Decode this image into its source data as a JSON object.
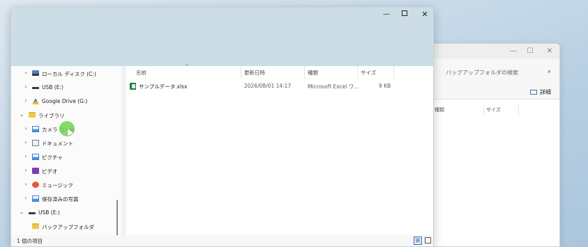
{
  "background_window": {
    "search_placeholder": "バックアップフォルダの検索",
    "detail_label": "詳細",
    "columns": [
      "種類",
      "サイズ"
    ],
    "controls": {
      "minimize": "—",
      "maximize": "☐",
      "close": "✕"
    }
  },
  "window": {
    "controls": {
      "minimize": "—",
      "close": "✕"
    }
  },
  "nav": {
    "items": [
      {
        "label": "ローカル ディスク (C:)",
        "icon": "drive-c-icon",
        "expanded": false
      },
      {
        "label": "USB (E:)",
        "icon": "usb-drive-icon",
        "expanded": false
      },
      {
        "label": "Google Drive (G:)",
        "icon": "google-drive-icon",
        "expanded": false
      },
      {
        "label": "ライブラリ",
        "icon": "folder-icon",
        "expanded": true
      },
      {
        "label": "カメラ ロール",
        "icon": "pictures-icon",
        "expanded": false
      },
      {
        "label": "ドキュメント",
        "icon": "documents-icon",
        "expanded": false
      },
      {
        "label": "ピクチャ",
        "icon": "pictures-icon",
        "expanded": false
      },
      {
        "label": "ビデオ",
        "icon": "video-icon",
        "expanded": false
      },
      {
        "label": "ミュージック",
        "icon": "music-icon",
        "expanded": false
      },
      {
        "label": "保存済みの写真",
        "icon": "pictures-icon",
        "expanded": false
      },
      {
        "label": "USB (E:)",
        "icon": "usb-drive-icon",
        "expanded": true
      },
      {
        "label": "バックアップフォルダ",
        "icon": "folder-icon",
        "expanded": false
      }
    ],
    "chevron_collapsed": "›",
    "chevron_expanded": "⌄"
  },
  "content": {
    "columns": {
      "name": "名前",
      "modified": "更新日時",
      "type": "種類",
      "size": "サイズ"
    },
    "sort_indicator": "^",
    "files": [
      {
        "name": "サンプルデータ.xlsx",
        "modified": "2026/08/01 14:17",
        "type": "Microsoft Excel ワ...",
        "size": "9 KB"
      }
    ]
  },
  "status": {
    "item_count": "1 個の項目"
  }
}
